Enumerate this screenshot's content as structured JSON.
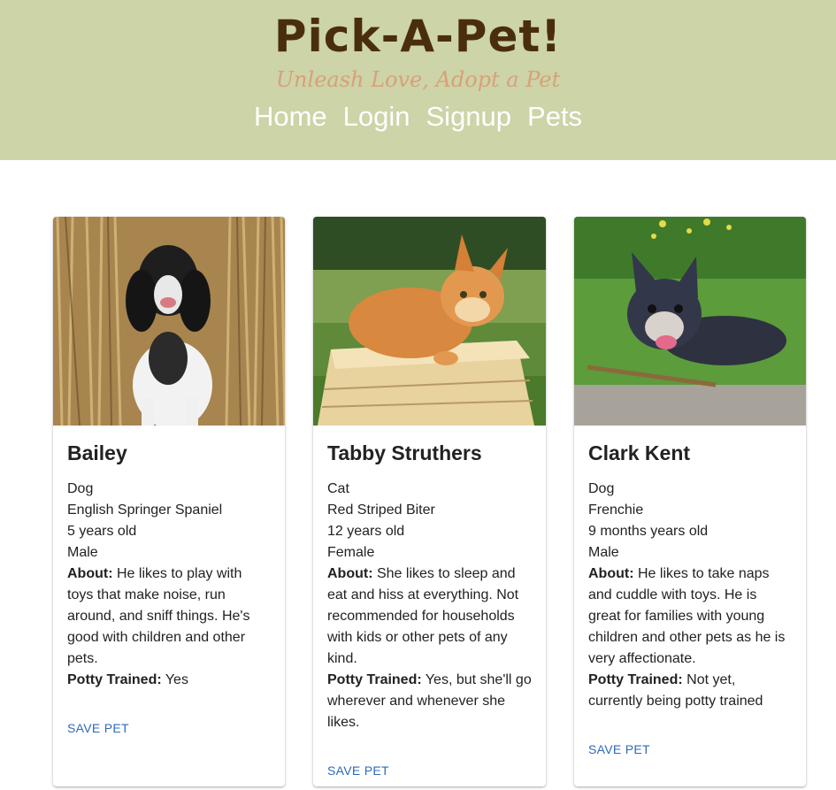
{
  "header": {
    "title": "Pick-A-Pet!",
    "tagline": "Unleash Love, Adopt a Pet",
    "nav": [
      "Home",
      "Login",
      "Signup",
      "Pets"
    ]
  },
  "labels": {
    "about": "About:",
    "potty": "Potty Trained:",
    "save": "SAVE PET"
  },
  "pets": [
    {
      "name": "Bailey",
      "species": "Dog",
      "breed": "English Springer Spaniel",
      "age": "5 years old",
      "sex": "Male",
      "about": "He likes to play with toys that make noise, run around, and sniff things. He's good with children and other pets.",
      "potty": "Yes",
      "photo": "spaniel-dog-in-wheat-field-photo"
    },
    {
      "name": "Tabby Struthers",
      "species": "Cat",
      "breed": "Red Striped Biter",
      "age": "12 years old",
      "sex": "Female",
      "about": "She likes to sleep and eat and hiss at everything. Not recommended for households with kids or other pets of any kind.",
      "potty": "Yes, but she'll go wherever and whenever she likes.",
      "photo": "orange-cat-on-wooden-crate-photo"
    },
    {
      "name": "Clark Kent",
      "species": "Dog",
      "breed": "Frenchie",
      "age": "9 months years old",
      "sex": "Male",
      "about": "He likes to take naps and cuddle with toys. He is great for families with young children and other pets as he is very affectionate.",
      "potty": "Not yet, currently being potty trained",
      "photo": "french-bulldog-in-grass-photo"
    }
  ],
  "colors": {
    "header_bg": "#ccd4a8",
    "title": "#4a2e0c",
    "tagline": "#d9a07a",
    "nav": "#ffffff",
    "button": "#2f6ab8"
  }
}
